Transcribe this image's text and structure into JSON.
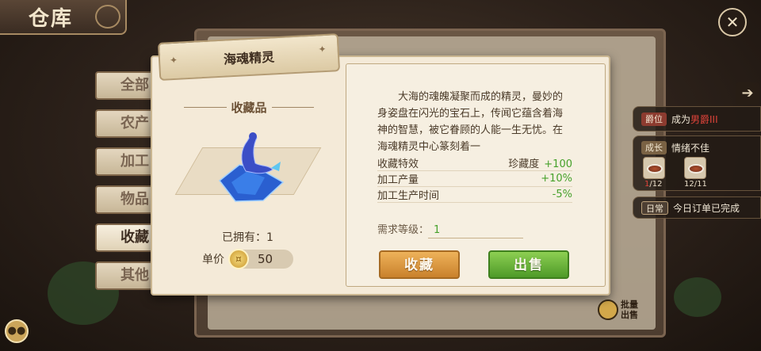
{
  "header": {
    "title": "仓库"
  },
  "sidebar": {
    "tabs": [
      {
        "label": "全部"
      },
      {
        "label": "农产"
      },
      {
        "label": "加工"
      },
      {
        "label": "物品"
      },
      {
        "label": "收藏"
      },
      {
        "label": "其他"
      }
    ],
    "active_index": 4
  },
  "right_panel": {
    "title_item": {
      "badge": "爵位",
      "text_prefix": "成为",
      "text_highlight": "男爵III"
    },
    "growth_item": {
      "badge": "成长",
      "text": "情绪不佳",
      "foods": [
        {
          "count_current": "1",
          "count_total": "/12"
        },
        {
          "count": "12/11"
        }
      ]
    },
    "daily_item": {
      "badge": "日常",
      "text": "今日订单已完成"
    }
  },
  "bulk_sell": {
    "label": "批量出售"
  },
  "item_modal": {
    "name": "海魂精灵",
    "category": "收藏品",
    "owned_label": "已拥有：",
    "owned_count": "1",
    "price_label": "单价",
    "price_value": "50",
    "description": "大海的魂魄凝聚而成的精灵，曼妙的身姿盘在闪光的宝石上，传闻它蕴含着海神的智慧，被它眷顾的人能一生无忧。在海魂精灵中心篆刻着一",
    "stats": [
      {
        "label": "收藏特效",
        "sub": "珍藏度",
        "value": "+100"
      },
      {
        "label": "加工产量",
        "value": "+10%"
      },
      {
        "label": "加工生产时间",
        "value": "-5%"
      }
    ],
    "required_level_label": "需求等级：",
    "required_level": "1",
    "collect_button": "收藏",
    "sell_button": "出售"
  },
  "colors": {
    "accent_green": "#46a12b",
    "accent_orange": "#c9812c",
    "highlight_red": "#e0433a"
  }
}
